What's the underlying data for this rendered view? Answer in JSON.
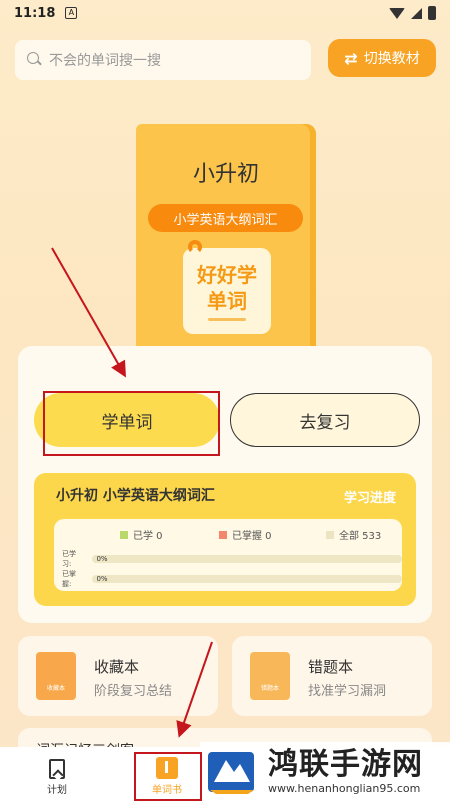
{
  "status_bar": {
    "time": "11:18",
    "notif": "A"
  },
  "search": {
    "placeholder": "不会的单词搜一搜"
  },
  "switch_button": {
    "label": "切换教材",
    "icon": "swap-arrows-icon"
  },
  "book": {
    "title": "小升初",
    "subtitle": "小学英语大纲词汇",
    "badge_line1": "好好学",
    "badge_line2": "单词"
  },
  "actions": {
    "learn_label": "学单词",
    "review_label": "去复习"
  },
  "progress": {
    "title": "小升初 小学英语大纲词汇",
    "label": "学习进度",
    "legend": [
      {
        "text": "已学 0",
        "color": "#b8d86b"
      },
      {
        "text": "已掌握 0",
        "color": "#f3866b"
      },
      {
        "text": "全部 533",
        "color": "#ece3c2"
      }
    ],
    "rows": [
      {
        "label": "已学习:",
        "pct": "0%",
        "value": 0
      },
      {
        "label": "已掌握:",
        "pct": "0%",
        "value": 0
      }
    ]
  },
  "tiles": [
    {
      "title": "收藏本",
      "subtitle": "阶段复习总结",
      "icon": "favorites-book-icon",
      "icon_text": "收藏本",
      "color": "#f8a84a"
    },
    {
      "title": "错题本",
      "subtitle": "找准学习漏洞",
      "icon": "mistakes-book-icon",
      "icon_text": "错题本",
      "color": "#f8b85a"
    }
  ],
  "partial_card": {
    "title": "词汇记忆三剑客"
  },
  "tabbar": {
    "plan_label": "计划",
    "wordbook_label": "单词书"
  },
  "watermark": {
    "title": "鸿联手游网",
    "url": "www.henanhonglian95.com"
  },
  "colors": {
    "accent": "#f8a323",
    "annotation": "#c4161c"
  }
}
